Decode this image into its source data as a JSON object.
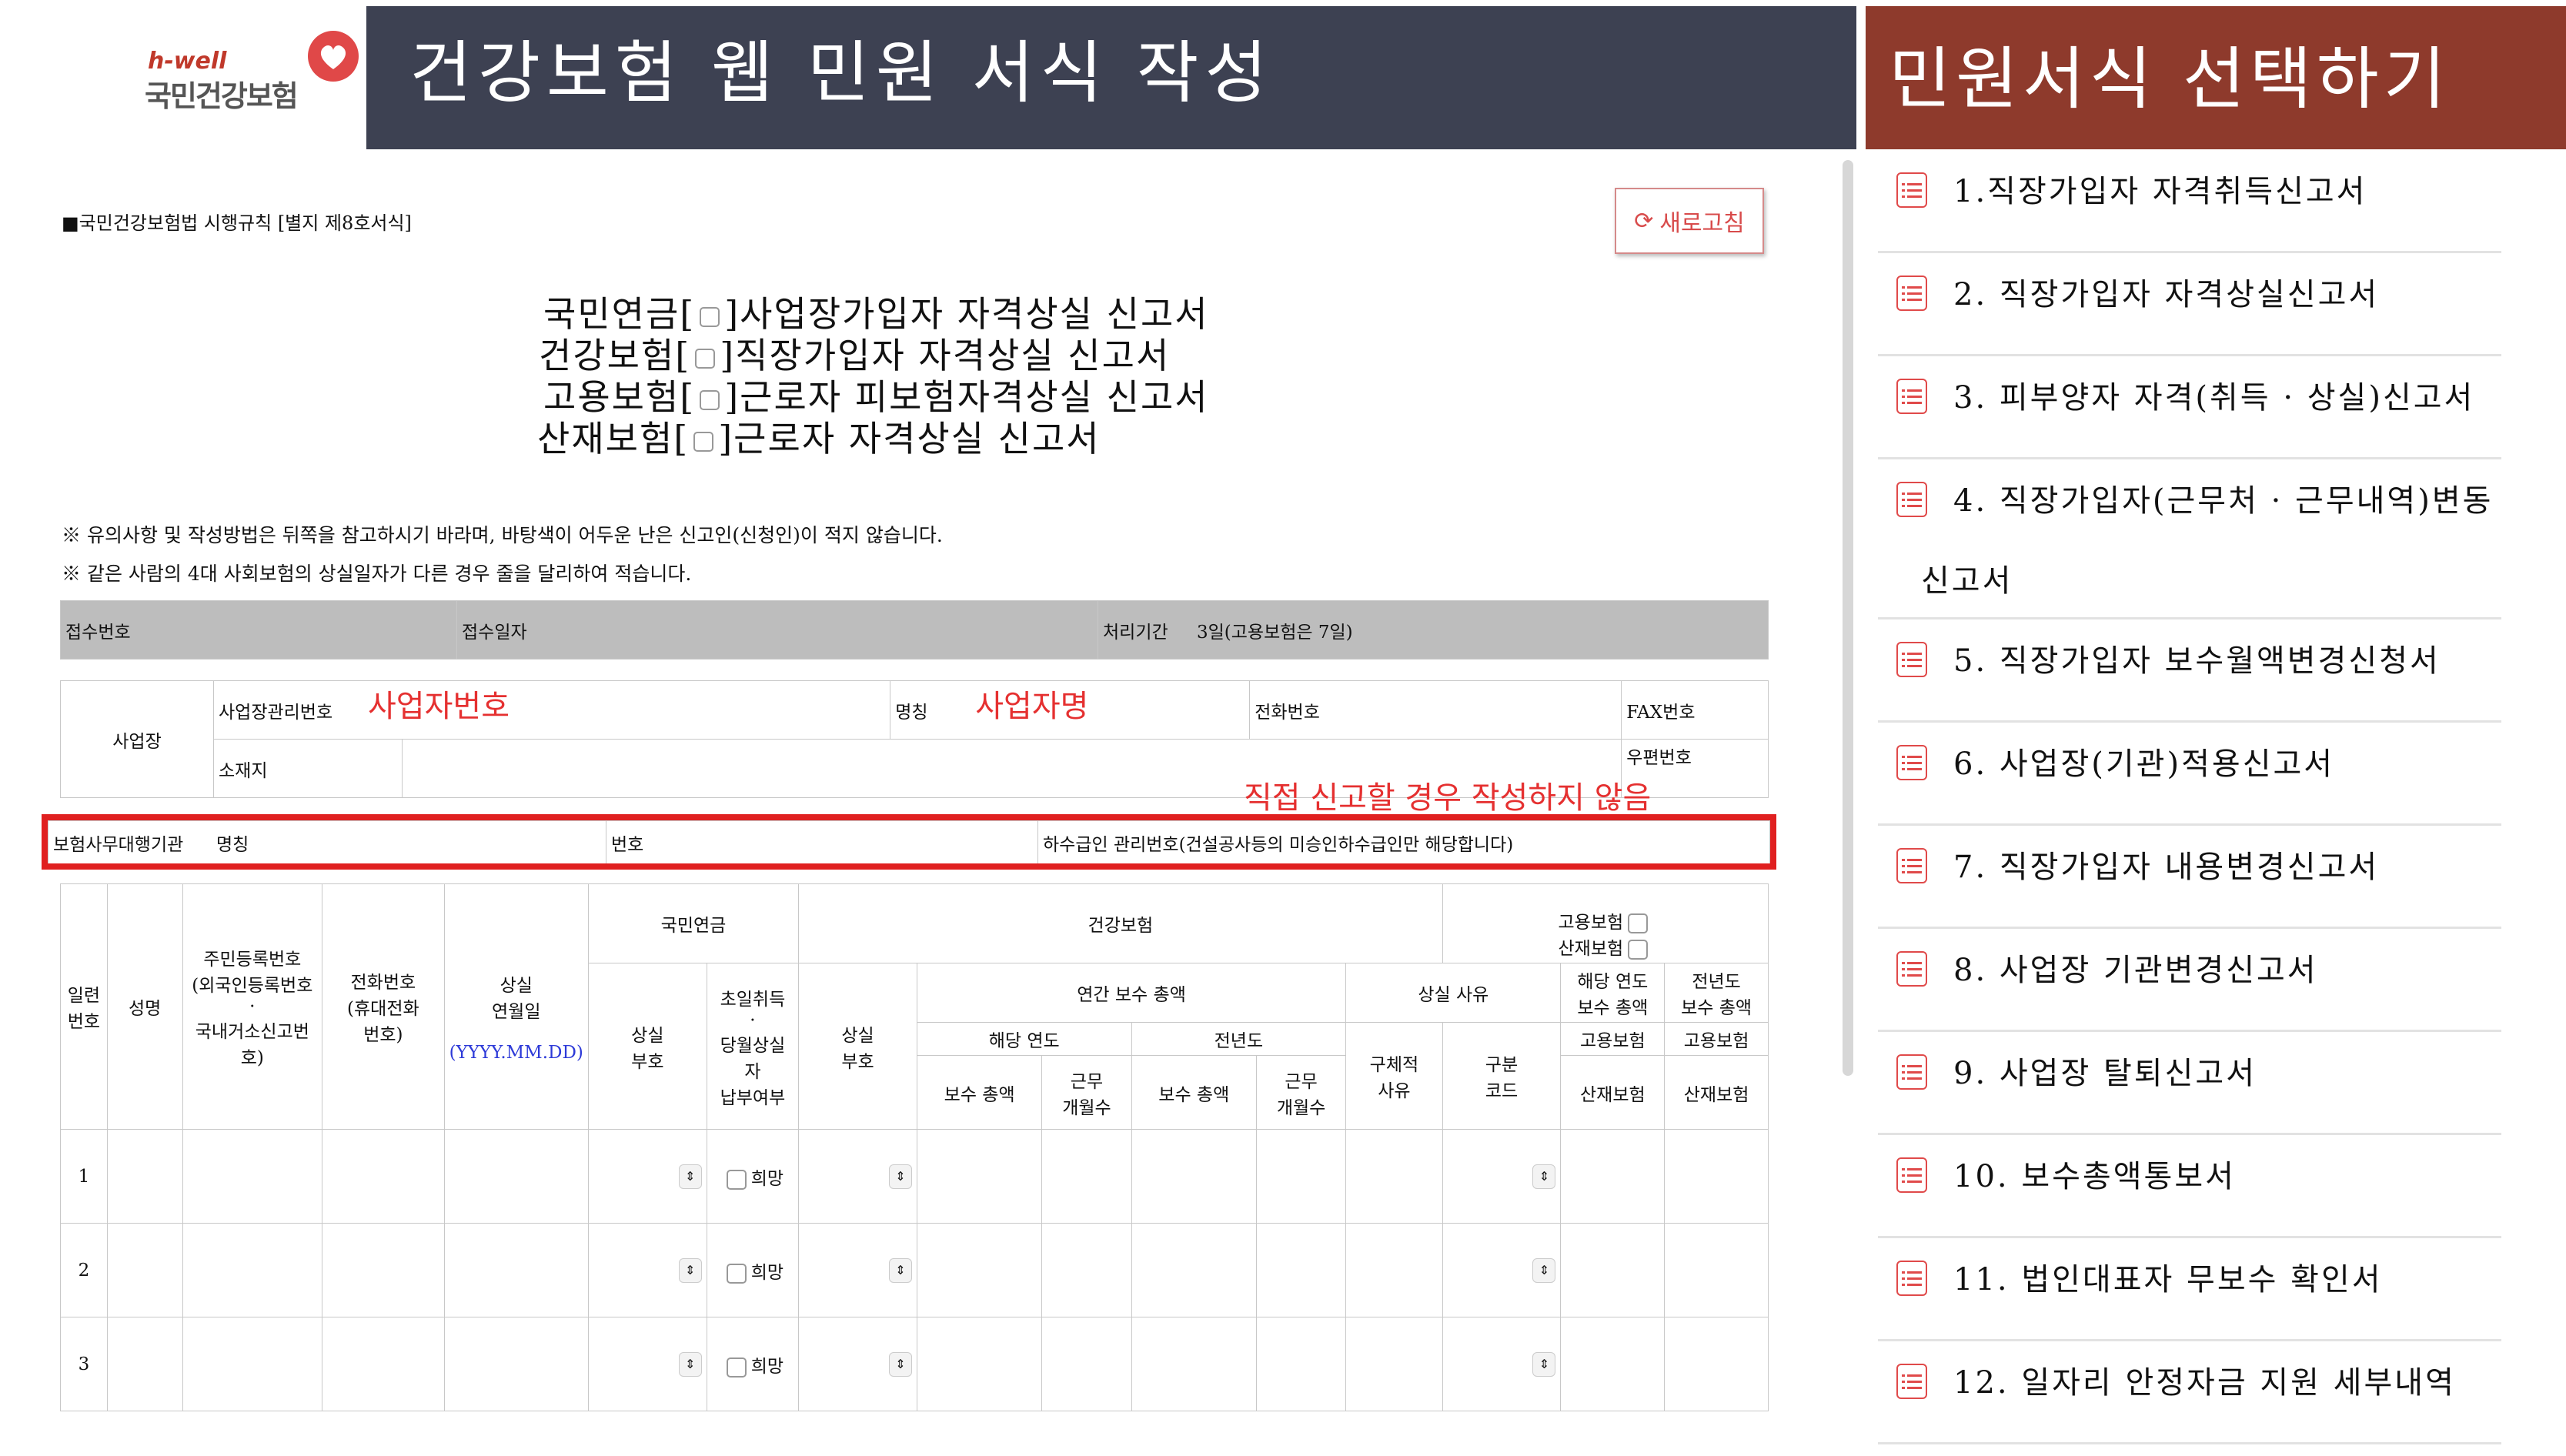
{
  "header": {
    "logo_brand": "h-well",
    "logo_name": "국민건강보험",
    "title": "건강보험 웹 민원 서식 작성",
    "menu_title": "민원서식 선택하기"
  },
  "form": {
    "law_ref": "■국민건강보험법 시행규칙 [별지 제8호서식]",
    "refresh_label": "새로고침",
    "titles": [
      {
        "prefix": "국민연금[",
        "suffix": "]사업장가입자 자격상실 신고서"
      },
      {
        "prefix": "건강보험[",
        "suffix": "]직장가입자 자격상실 신고서"
      },
      {
        "prefix": "고용보험[",
        "suffix": "]근로자 피보험자격상실 신고서"
      },
      {
        "prefix": "산재보험[",
        "suffix": "]근로자 자격상실 신고서"
      }
    ],
    "notes": [
      "※ 유의사항 및 작성방법은 뒤쪽을 참고하시기 바라며, 바탕색이 어두운 난은 신고인(신청인)이 적지 않습니다.",
      "※ 같은 사람의 4대 사회보험의 상실일자가 다른 경우 줄을 달리하여 적습니다."
    ],
    "receipt": {
      "number_label": "접수번호",
      "date_label": "접수일자",
      "period_label": "처리기간",
      "period_value": "3일(고용보험은 7일)"
    },
    "workplace": {
      "label": "사업장",
      "mgmt_no_label": "사업장관리번호",
      "mgmt_no_annotation": "사업자번호",
      "name_label": "명칭",
      "name_annotation": "사업자명",
      "phone_label": "전화번호",
      "fax_label": "FAX번호",
      "address_label": "소재지",
      "zip_label": "우편번호"
    },
    "agency": {
      "annotation": "직접 신고할 경우 작성하지 않음",
      "label": "보험사무대행기관",
      "name_label": "명칭",
      "number_label": "번호",
      "subcontract_label": "하수급인 관리번호(건설공사등의 미승인하수급인만 해당합니다)"
    },
    "table": {
      "serial": "일련\n번호",
      "name": "성명",
      "rrn": "주민등록번호\n(외국인등록번호\n·\n국내거소신고번\n호)",
      "phone": "전화번호\n(휴대전화\n번호)",
      "loss_date": "상실\n연월일",
      "date_format": "(YYYY.MM.DD)",
      "pension": "국민연금",
      "pension_code": "상실\n부호",
      "pension_first": "초일취득\n·\n당월상실\n자\n납부여부",
      "health": "건강보험",
      "health_code": "상실\n부호",
      "annual_total": "연간 보수 총액",
      "this_year": "해당 연도",
      "prev_year": "전년도",
      "pay_total": "보수 총액",
      "months_worked": "근무\n개월수",
      "employment": "고용보험",
      "industrial": "산재보험",
      "loss_reason": "상실 사유",
      "reason_detail": "구체적\n사유",
      "reason_code": "구분\n코드",
      "this_year_total": "해당 연도\n보수 총액",
      "prev_year_total": "전년도\n보수 총액",
      "emp_short": "고용보험",
      "ind_short": "산재보험",
      "hope": "희망",
      "rows": [
        "1",
        "2",
        "3"
      ]
    }
  },
  "menu": {
    "items": [
      {
        "label": "1.직장가입자 자격취득신고서"
      },
      {
        "label": "2. 직장가입자 자격상실신고서"
      },
      {
        "label": "3. 피부양자 자격(취득 · 상실)신고서"
      },
      {
        "label": "4. 직장가입자(근무처 · 근무내역)변동",
        "label2": "신고서"
      },
      {
        "label": "5. 직장가입자 보수월액변경신청서"
      },
      {
        "label": "6. 사업장(기관)적용신고서"
      },
      {
        "label": "7. 직장가입자 내용변경신고서"
      },
      {
        "label": "8. 사업장 기관변경신고서"
      },
      {
        "label": "9. 사업장 탈퇴신고서"
      },
      {
        "label": "10. 보수총액통보서"
      },
      {
        "label": "11. 법인대표자 무보수 확인서"
      },
      {
        "label": "12. 일자리 안정자금 지원 세부내역"
      }
    ]
  },
  "colors": {
    "title_bar": "#3d4152",
    "menu_bar": "#8e3a2c",
    "annotation_red": "#e53030",
    "receipt_gray": "#bdbdbd"
  }
}
